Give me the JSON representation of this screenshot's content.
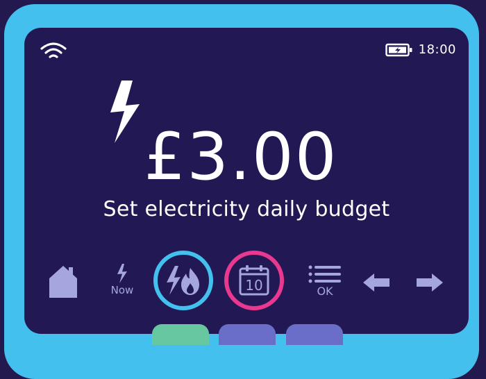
{
  "status_bar": {
    "time": "18:00"
  },
  "budget": {
    "amount": "£3.00",
    "caption": "Set electricity daily budget"
  },
  "nav": {
    "now_label": "Now",
    "calendar_day": "10",
    "ok_label": "OK"
  },
  "colors": {
    "background": "#23194f",
    "frame": "#43c0ee",
    "screen": "#221853",
    "text": "#ffffff",
    "muted_icon": "#a6a6de",
    "fuel_ring": "#43c0ee",
    "calendar_ring": "#e8388f",
    "tab_1": "#66c7a0",
    "tab_2": "#6a6ec8",
    "tab_3": "#6a6ec8"
  }
}
